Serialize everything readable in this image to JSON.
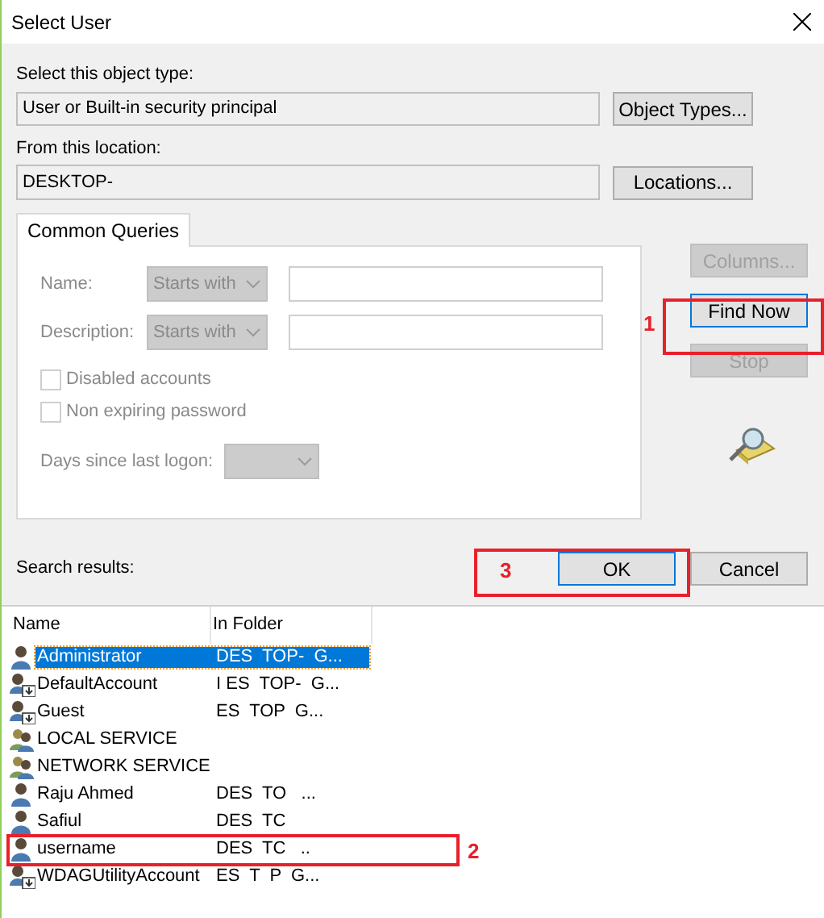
{
  "window": {
    "title": "Select User"
  },
  "object_type": {
    "label": "Select this object type:",
    "value": "User or Built-in security principal",
    "button": "Object Types..."
  },
  "location": {
    "label": "From this location:",
    "value": "DESKTOP-",
    "button": "Locations..."
  },
  "tabs": [
    {
      "label": "Common Queries",
      "selected": true
    }
  ],
  "query": {
    "fields": [
      {
        "label": "Name:",
        "mode": "Starts with",
        "disabled": true
      },
      {
        "label": "Description:",
        "mode": "Starts with",
        "disabled": true
      }
    ],
    "checkboxes": [
      {
        "label": "Disabled accounts",
        "checked": false
      },
      {
        "label": "Non expiring password",
        "checked": false
      }
    ],
    "days_label": "Days since last logon:"
  },
  "side_buttons": [
    {
      "label": "Columns...",
      "disabled": true,
      "focused": false
    },
    {
      "label": "Find Now",
      "disabled": false,
      "focused": true
    },
    {
      "label": "Stop",
      "disabled": true,
      "focused": false
    }
  ],
  "results_label": "Search results:",
  "dialog_buttons": [
    {
      "label": "OK",
      "focused": true
    },
    {
      "label": "Cancel",
      "focused": false
    }
  ],
  "table": {
    "columns": [
      "Name",
      "In Folder"
    ],
    "rows": [
      {
        "name": "Administrator",
        "folder": "DES  TOP-  G...",
        "kind": "user",
        "selected": true
      },
      {
        "name": "DefaultAccount",
        "folder": "I ES  TOP-  G...",
        "kind": "account",
        "selected": false
      },
      {
        "name": "Guest",
        "folder": "ES  TOP  G...",
        "kind": "account",
        "selected": false
      },
      {
        "name": "LOCAL SERVICE",
        "folder": "",
        "kind": "group",
        "selected": false
      },
      {
        "name": "NETWORK SERVICE",
        "folder": "",
        "kind": "group",
        "selected": false
      },
      {
        "name": "Raju Ahmed",
        "folder": "DES  TO   ...",
        "kind": "user",
        "selected": false
      },
      {
        "name": "Safiul",
        "folder": "DES  TC",
        "kind": "user",
        "selected": false
      },
      {
        "name": "username",
        "folder": "DES  TC   ..",
        "kind": "user",
        "selected": false
      },
      {
        "name": "WDAGUtilityAccount",
        "folder": "ES  T  P  G...",
        "kind": "account",
        "selected": false
      }
    ]
  },
  "annotations": [
    {
      "label": "1"
    },
    {
      "label": "2"
    },
    {
      "label": "3"
    }
  ]
}
